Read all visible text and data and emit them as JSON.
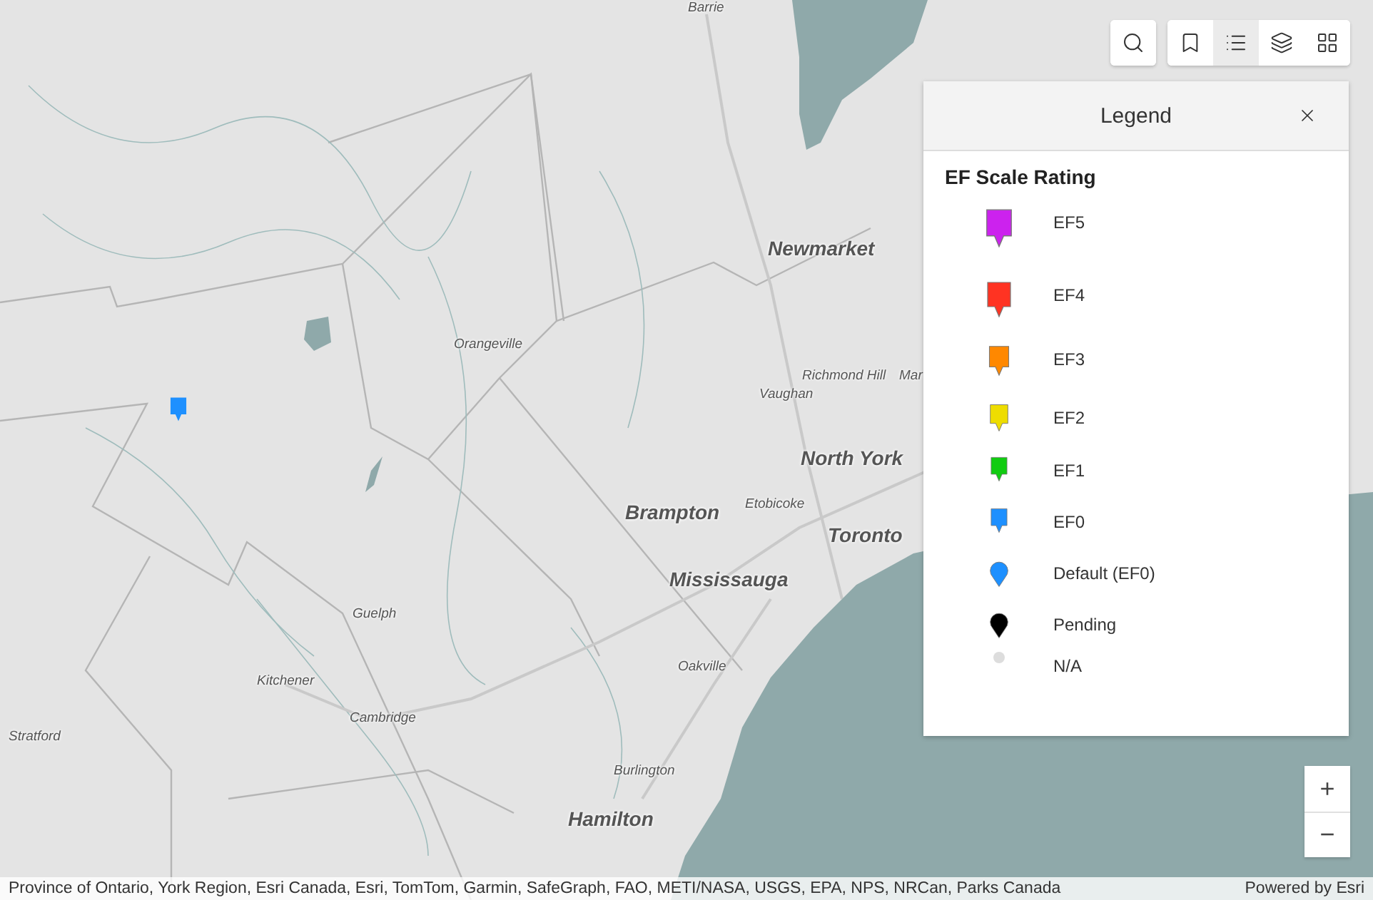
{
  "map": {
    "labels": [
      {
        "text": "Barrie",
        "major": false
      },
      {
        "text": "Newmarket",
        "major": true
      },
      {
        "text": "Orangeville",
        "major": false
      },
      {
        "text": "Richmond Hill",
        "major": false
      },
      {
        "text": "Vaughan",
        "major": false
      },
      {
        "text": "Mar",
        "major": false
      },
      {
        "text": "North York",
        "major": true
      },
      {
        "text": "Etobicoke",
        "major": false
      },
      {
        "text": "Brampton",
        "major": true
      },
      {
        "text": "Toronto",
        "major": true
      },
      {
        "text": "Mississauga",
        "major": true
      },
      {
        "text": "Guelph",
        "major": false
      },
      {
        "text": "Kitchener",
        "major": false
      },
      {
        "text": "Cambridge",
        "major": false
      },
      {
        "text": "Stratford",
        "major": false
      },
      {
        "text": "Oakville",
        "major": false
      },
      {
        "text": "Burlington",
        "major": false
      },
      {
        "text": "Hamilton",
        "major": true
      }
    ],
    "markers": [
      {
        "color": "#1e90ff"
      }
    ]
  },
  "toolbar": {
    "tools": [
      {
        "selected": false
      },
      {
        "selected": true
      },
      {
        "selected": false
      },
      {
        "selected": false
      }
    ]
  },
  "legend": {
    "title": "Legend",
    "layer_title": "EF Scale Rating",
    "items": [
      {
        "label": "EF5",
        "kind": "square-pin",
        "color": "#cc22ee"
      },
      {
        "label": "EF4",
        "kind": "square-pin",
        "color": "#ff3322"
      },
      {
        "label": "EF3",
        "kind": "square-pin",
        "color": "#ff8800"
      },
      {
        "label": "EF2",
        "kind": "square-pin",
        "color": "#eedd00"
      },
      {
        "label": "EF1",
        "kind": "square-pin",
        "color": "#11cc11"
      },
      {
        "label": "EF0",
        "kind": "square-pin",
        "color": "#1e90ff"
      },
      {
        "label": "Default (EF0)",
        "kind": "round-pin",
        "color": "#1e90ff"
      },
      {
        "label": "Pending",
        "kind": "round-pin",
        "color": "#000000"
      },
      {
        "label": "N/A",
        "kind": "dot",
        "color": "#dddddd"
      }
    ]
  },
  "zoom": {
    "in": "+",
    "out": "−"
  },
  "attribution": {
    "sources": "Province of Ontario, York Region, Esri Canada, Esri, TomTom, Garmin, SafeGraph, FAO, METI/NASA, USGS, EPA, NPS, NRCan, Parks Canada",
    "powered_by": "Powered by Esri"
  }
}
